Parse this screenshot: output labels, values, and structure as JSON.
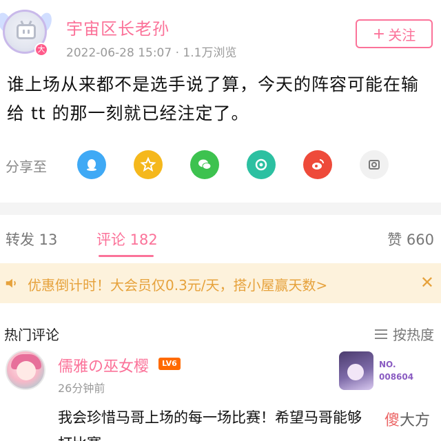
{
  "post": {
    "author": "宇宙区长老孙",
    "vip_badge": "大",
    "meta": "2022-06-28 15:07 · 1.1万浏览",
    "follow_label": "关注",
    "text": "谁上场从来都不是选手说了算，今天的阵容可能在输给 tt 的那一刻就已经注定了。"
  },
  "share": {
    "label": "分享至",
    "targets": [
      "qq-icon",
      "qzone-icon",
      "wechat-icon",
      "moments-icon",
      "weibo-icon",
      "copy-link-icon"
    ]
  },
  "tabs": [
    {
      "label": "转发 13"
    },
    {
      "label": "评论 182"
    },
    {
      "label": "赞 660"
    }
  ],
  "promo": {
    "text": "优惠倒计时！大会员仅0.3元/天，搭小屋赢天数>",
    "close": "✕"
  },
  "hot_comments": {
    "title": "热门评论",
    "sort_label": "按热度",
    "items": [
      {
        "user": "儒雅の巫女樱",
        "level": "LV6",
        "time": "26分钟前",
        "text": "我会珍惜马哥上场的每一场比赛！希望马哥能够",
        "text_line2": "打比赛",
        "fan_no": "NO.",
        "fan_number": "008604"
      }
    ]
  },
  "watermark": {
    "first": "傻",
    "rest": "大方"
  },
  "colors": {
    "accent": "#fb7299",
    "promo_bg": "#fdf2dc",
    "promo_text": "#e6a23c"
  }
}
